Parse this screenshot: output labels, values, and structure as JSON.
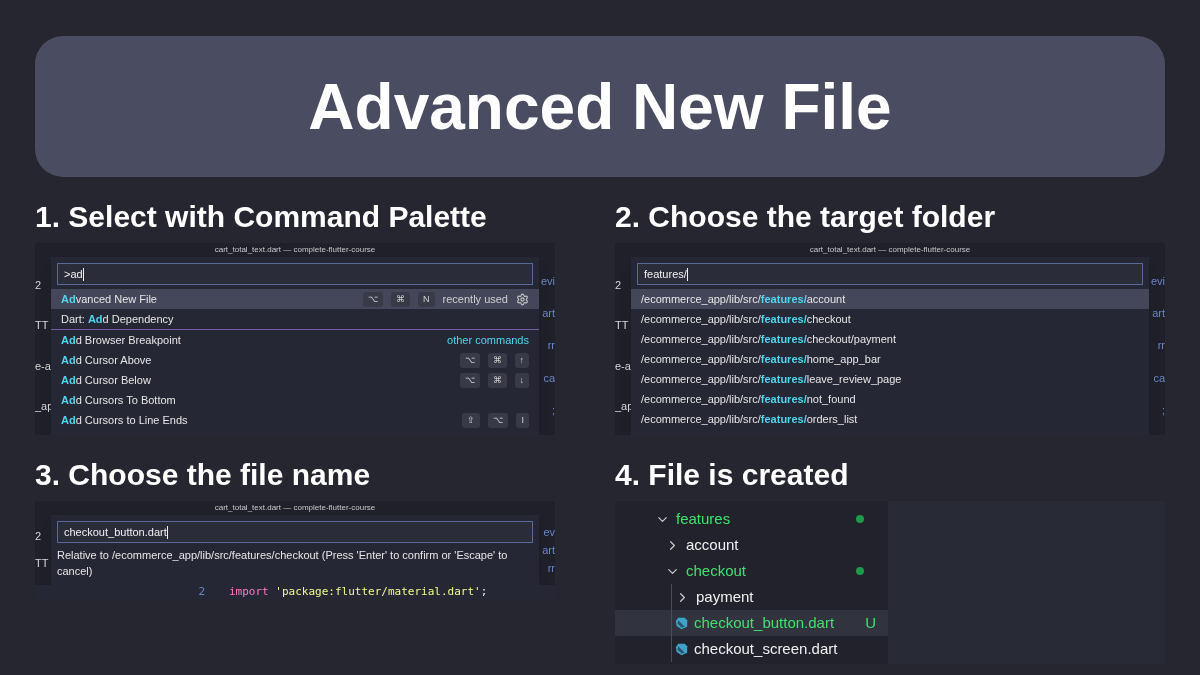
{
  "banner": {
    "title": "Advanced New File"
  },
  "steps": [
    {
      "kind": "palette",
      "heading": "1. Select with Command Palette",
      "window_title": "cart_total_text.dart — complete-flutter-course",
      "input": ">ad",
      "left_edge": [
        "2",
        "TT",
        "e-a",
        "_ap"
      ],
      "right_edge": [
        "evi",
        "art",
        "rr",
        "ca",
        ";"
      ],
      "items": [
        {
          "label": "**Ad**vanced New File",
          "selected": true,
          "keys": [
            "⌥",
            "⌘",
            "N"
          ],
          "note": "recently used",
          "gear": true
        },
        {
          "label": "Dart: **Ad**d Dependency",
          "selected": false
        },
        {
          "label": "**Ad**d Browser Breakpoint",
          "selected": false,
          "group_label": "other commands"
        },
        {
          "label": "**Ad**d Cursor Above",
          "selected": false,
          "keys": [
            "⌥",
            "⌘",
            "↑"
          ]
        },
        {
          "label": "**Ad**d Cursor Below",
          "selected": false,
          "keys": [
            "⌥",
            "⌘",
            "↓"
          ]
        },
        {
          "label": "**Ad**d Cursors To Bottom",
          "selected": false
        },
        {
          "label": "**Ad**d Cursors to Line Ends",
          "selected": false,
          "keys": [
            "⇧",
            "⌥",
            "I"
          ]
        }
      ]
    },
    {
      "kind": "palette",
      "heading": "2. Choose the target folder",
      "window_title": "cart_total_text.dart — complete-flutter-course",
      "input": "features/",
      "left_edge": [
        "2",
        "TT",
        "e-a",
        "_ap"
      ],
      "right_edge": [
        "evi",
        "art",
        "rr",
        "ca",
        ";"
      ],
      "items": [
        {
          "label": "/ecommerce_app/lib/src/**features/**account",
          "selected": true
        },
        {
          "label": "/ecommerce_app/lib/src/**features/**checkout",
          "selected": false
        },
        {
          "label": "/ecommerce_app/lib/src/**features/**checkout/payment",
          "selected": false
        },
        {
          "label": "/ecommerce_app/lib/src/**features/**home_app_bar",
          "selected": false
        },
        {
          "label": "/ecommerce_app/lib/src/**features/**leave_review_page",
          "selected": false
        },
        {
          "label": "/ecommerce_app/lib/src/**features/**not_found",
          "selected": false
        },
        {
          "label": "/ecommerce_app/lib/src/**features/**orders_list",
          "selected": false
        }
      ]
    },
    {
      "kind": "prompt",
      "heading": "3. Choose the file name",
      "window_title": "cart_total_text.dart — complete-flutter-course",
      "input": "checkout_button.dart",
      "left_edge": [
        "2",
        "TT"
      ],
      "right_edge": [
        "ev",
        "art",
        "rr"
      ],
      "message": "Relative to /ecommerce_app/lib/src/features/checkout (Press 'Enter' to confirm or 'Escape' to cancel)",
      "code_line": {
        "number": "2",
        "tokens": [
          {
            "text": "import",
            "kind": "keyword"
          },
          {
            "text": "'package:flutter/material.dart'",
            "kind": "string"
          },
          {
            "text": ";",
            "kind": "punct"
          }
        ]
      }
    },
    {
      "kind": "tree",
      "heading": "4. File is created",
      "tree": [
        {
          "kind": "folder",
          "label": "features",
          "expanded": true,
          "modified": true,
          "selected": false,
          "children": [
            {
              "kind": "folder",
              "label": "account",
              "expanded": false,
              "modified": false,
              "selected": false
            },
            {
              "kind": "folder",
              "label": "checkout",
              "expanded": true,
              "modified": true,
              "selected": false,
              "children": [
                {
                  "kind": "folder",
                  "label": "payment",
                  "expanded": false,
                  "modified": false,
                  "selected": false
                },
                {
                  "kind": "file",
                  "label": "checkout_button.dart",
                  "selected": true,
                  "badge": "U"
                },
                {
                  "kind": "file",
                  "label": "checkout_screen.dart",
                  "selected": false
                }
              ]
            }
          ]
        }
      ]
    }
  ]
}
